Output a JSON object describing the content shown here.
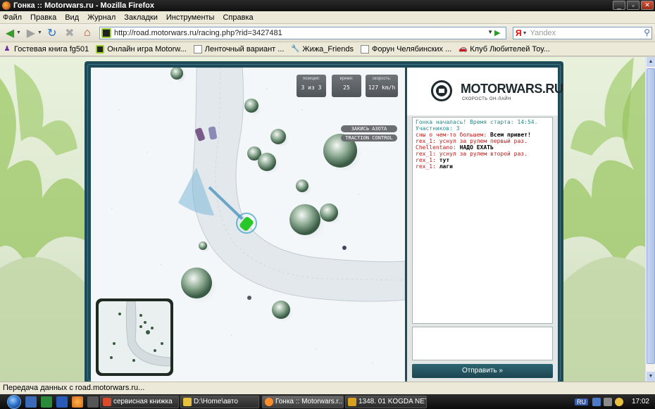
{
  "window": {
    "title": "Гонка :: Motorwars.ru - Mozilla Firefox"
  },
  "menu": [
    "Файл",
    "Правка",
    "Вид",
    "Журнал",
    "Закладки",
    "Инструменты",
    "Справка"
  ],
  "nav": {
    "url": "http://road.motorwars.ru/racing.php?rid=3427481",
    "search_placeholder": "Yandex",
    "search_engine_letter": "Я"
  },
  "bookmarks": [
    {
      "label": "Гостевая книга fg501",
      "icon": "person-icon"
    },
    {
      "label": "Онлайн игра Motorw...",
      "icon": "motorwars-icon"
    },
    {
      "label": "Ленточный вариант ...",
      "icon": "page-icon"
    },
    {
      "label": "Жижа_Friends",
      "icon": "wrench-icon"
    },
    {
      "label": "Форун Челябинских ...",
      "icon": "page-icon"
    },
    {
      "label": "Клуб Любителей Тоу...",
      "icon": "car-icon"
    }
  ],
  "hud": {
    "position_label": "позиция:",
    "position_value": "3 из 3",
    "time_label": "время:",
    "time_value": "25",
    "speed_label": "скорость:",
    "speed_value": "127 km/h",
    "nitro_button": "ЗАКИСЬ АЗОТА",
    "traction_button": "TRACTION CONTROL"
  },
  "logo": {
    "name": "MOTORWARS.RU",
    "tagline": "СКОРОСТЬ ОН-ЛАЙН"
  },
  "chat": {
    "lines": [
      {
        "text": "Гонка началась! Время старта: 14:54. Участников: 3",
        "color": "#2a8a8a"
      },
      {
        "text": "сны о чем-то большем: Всем привет!",
        "color": "#c01818",
        "bold_part": "Всем привет!"
      },
      {
        "text": "rex_1: уснул за рулем первый раз.",
        "color": "#c01818"
      },
      {
        "text": "Chellentano: НАДО ЕХАТЬ",
        "color": "#c01818",
        "bold_part": "НАДО ЕХАТЬ"
      },
      {
        "text": "rex_1: уснул за рулем второй раз.",
        "color": "#c01818"
      },
      {
        "text": "rex_1: тут",
        "color": "#c01818",
        "bold_part": "тут"
      },
      {
        "text": "rex_1: лаги",
        "color": "#c01818",
        "bold_part": "лаги"
      }
    ],
    "send_button": "Отправить »"
  },
  "status": "Передача данных с road.motorwars.ru...",
  "taskbar": {
    "tasks": [
      {
        "label": "сервисная книжка",
        "icon_color": "#d84a2a"
      },
      {
        "label": "D:\\Home\\авто",
        "icon_color": "#e8c040"
      },
      {
        "label": "Гонка :: Motorwars.r...",
        "icon_color": "#ff8c2a",
        "active": true
      },
      {
        "label": "1348. 01 KOGDA NET ...",
        "icon_color": "#d8a020"
      }
    ],
    "lang": "RU",
    "clock": "17:02"
  }
}
